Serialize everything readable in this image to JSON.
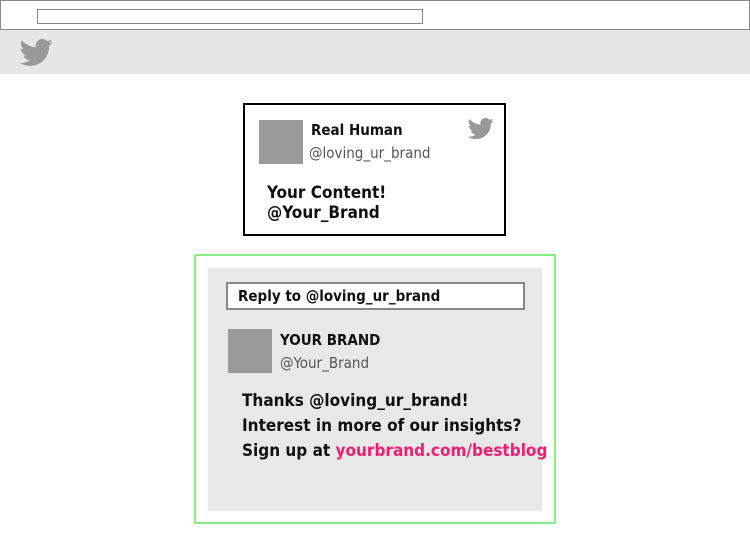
{
  "browser": {
    "url": ""
  },
  "header": {
    "logo_icon": "twitter-bird-icon",
    "logo_color": "#999999"
  },
  "tweet": {
    "author_name": "Real Human",
    "author_handle": "@loving_ur_brand",
    "content": "Your Content! @Your_Brand",
    "corner_icon": "twitter-bird-icon",
    "corner_icon_color": "#999999"
  },
  "reply": {
    "input_value": "Reply to @loving_ur_brand",
    "author_name": "YOUR BRAND",
    "author_handle": "@Your_Brand",
    "line1": "Thanks @loving_ur_brand!",
    "line2": "Interest in more of our insights?",
    "line3_prefix": "Sign up at ",
    "link_text": "yourbrand.com/bestblog",
    "link_color": "#ee1f72",
    "highlight_color": "#86ee86"
  }
}
